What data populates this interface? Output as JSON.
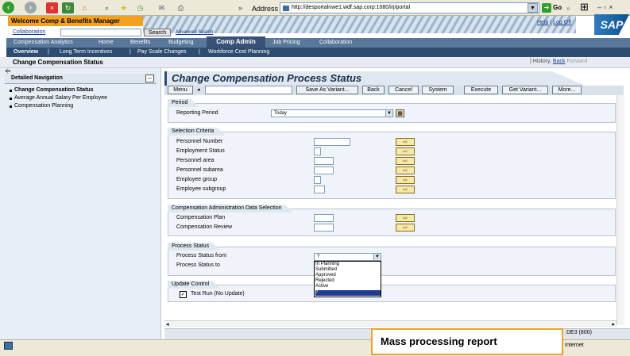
{
  "browser": {
    "address_label": "Address",
    "url": "http://desportalnwe1.wdf.sap.corp:1080/irj/portal",
    "go_label": "Go",
    "links_label": "»"
  },
  "portal": {
    "header_title": "Welcome Comp & Benefits Manager",
    "help_link": "Help",
    "logoff_link": "Log Off",
    "logo": "SAP",
    "collaboration_link": "Collaboration",
    "search_button": "Search",
    "advanced_search": "Advanced Search",
    "top_nav": [
      "Compensation Analytics",
      "Home",
      "Benefits",
      "Budgeting",
      "Comp Admin",
      "Job Pricing",
      "Collaboration"
    ],
    "sub_nav": [
      "Overview",
      "Long Term Incentives",
      "Pay Scale Changes",
      "Workforce Cost Planning"
    ],
    "page_title": "Change Compensation Status",
    "history_label": "History",
    "back_label": "Back",
    "forward_label": "Forward"
  },
  "left_nav": {
    "header": "Detailed Navigation",
    "items": [
      "Change Compensation Status",
      "Average Annual Salary Per Employee",
      "Compensation Planning"
    ]
  },
  "app": {
    "title": "Change Compensation Process Status",
    "toolbar": {
      "menu": "Menu",
      "save_as_variant": "Save As Variant...",
      "back": "Back",
      "cancel": "Cancel",
      "system": "System",
      "execute": "Execute",
      "get_variant": "Get Variant...",
      "more": "More..."
    },
    "period": {
      "group_label": "Period",
      "reporting_period_label": "Reporting Period",
      "reporting_period_value": "Today"
    },
    "selection_criteria": {
      "group_label": "Selection Criteria",
      "fields": [
        "Personnel Number",
        "Employment Status",
        "Personnel area",
        "Personnel subarea",
        "Employee group",
        "Employee subgroup"
      ]
    },
    "comp_admin": {
      "group_label": "Compensation Administration Data Selection",
      "fields": [
        "Compensation Plan",
        "Compensation Review"
      ]
    },
    "process_status": {
      "group_label": "Process Status",
      "from_label": "Process Status from",
      "to_label": "Process Status to",
      "from_value": "?",
      "options": [
        "In Planning",
        "Submitted",
        "Approved",
        "Rejected",
        "Active",
        "?"
      ]
    },
    "update_control": {
      "group_label": "Update Control",
      "test_run_label": "Test Run (No Update)",
      "test_run_checked": true
    },
    "status": {
      "system_info": "DE3 (800)"
    }
  },
  "ie_status": {
    "zone": "Internet"
  },
  "callout": {
    "text": "Mass processing report"
  },
  "colors": {
    "portal_orange": "#f4a21d",
    "nav_blue": "#58779a",
    "subnav_blue": "#2d4c70",
    "dropdown_highlight": "#1f3c8f"
  }
}
